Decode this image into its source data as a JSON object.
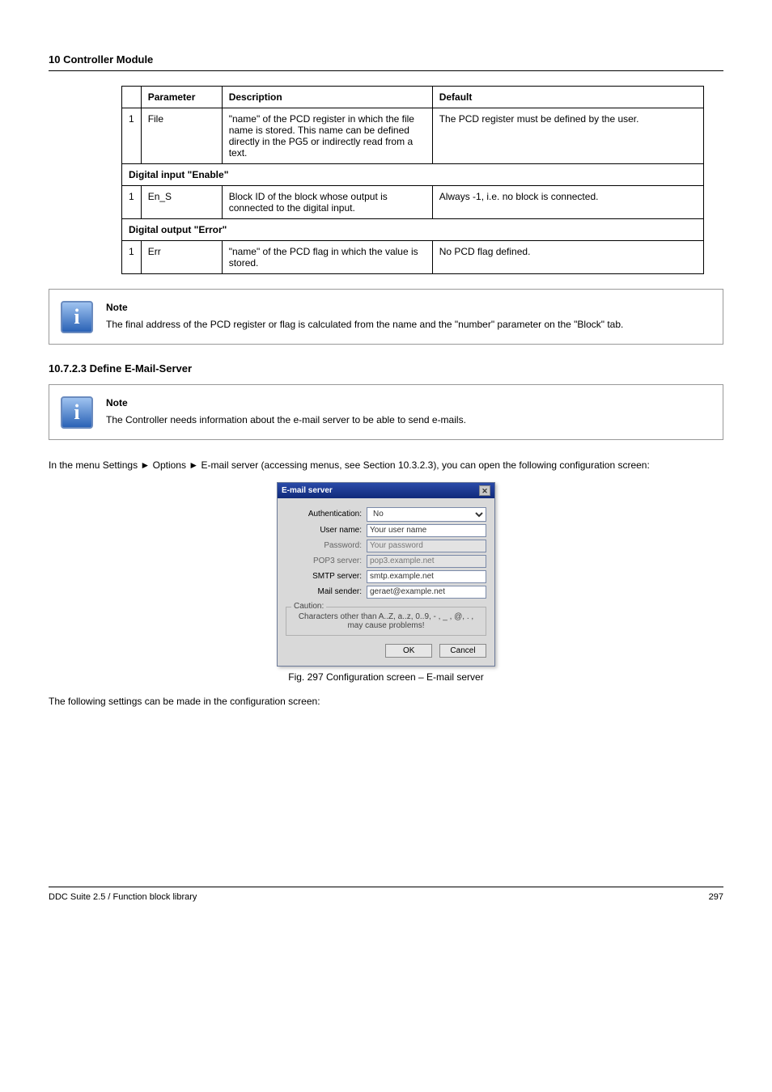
{
  "header": {
    "section_title": "10 Controller Module"
  },
  "table": {
    "cols": [
      "Parameter",
      "Description",
      "Default"
    ],
    "row_file": {
      "num": "1",
      "param": "File",
      "desc": "\"name\" of the PCD register in which the file name is stored. This name can be defined directly in the PG5 or indirectly read from a text.",
      "def": "The PCD register must be defined by the user."
    },
    "group_din": "Digital input \"Enable\"",
    "row_en": {
      "num": "1",
      "param": "En_S",
      "desc": "Block ID of the block whose output is connected to the digital input.",
      "def": "Always -1, i.e. no block is connected."
    },
    "group_dout": "Digital output \"Error\"",
    "row_err": {
      "num": "1",
      "param": "Err",
      "desc": "\"name\" of the PCD flag in which the value is stored.",
      "def": "No PCD flag defined."
    }
  },
  "note1": {
    "title": "Note",
    "body": "The final address of the PCD register or flag is calculated from the name and the \"number\" parameter on the \"Block\" tab."
  },
  "sub_heading": "10.7.2.3 Define E-Mail-Server",
  "note2": {
    "title": "Note",
    "body": "The Controller needs information about the e-mail server to be able to send e-mails."
  },
  "p_intro": "In the menu Settings ► Options ► E-mail server (accessing menus, see Section 10.3.2.3), you can open the following configuration screen:",
  "dialog": {
    "title": "E-mail server",
    "labels": {
      "auth": "Authentication:",
      "user": "User name:",
      "pass": "Password:",
      "pop3": "POP3 server:",
      "smtp": "SMTP server:",
      "sender": "Mail sender:"
    },
    "values": {
      "auth": "No",
      "user": "Your user name",
      "pass": "Your password",
      "pop3": "pop3.example.net",
      "smtp": "smtp.example.net",
      "sender": "geraet@example.net"
    },
    "caution_legend": "Caution:",
    "caution_text": "Characters other than A..Z, a..z, 0..9, - , _ , @, . , may cause problems!",
    "ok": "OK",
    "cancel": "Cancel"
  },
  "fig_caption": "Fig. 297  Configuration screen – E-mail server",
  "p_below": "The following settings can be made in the configuration screen:",
  "footer": {
    "left": "DDC Suite 2.5 / Function block library",
    "right": "297"
  }
}
